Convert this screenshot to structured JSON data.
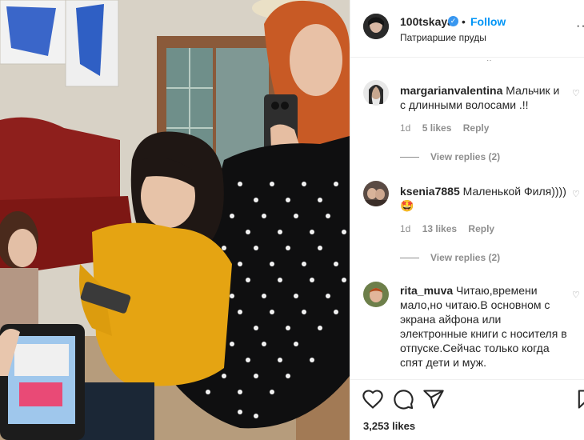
{
  "post": {
    "username": "100tskaya",
    "verified_icon": "verified-badge-icon",
    "separator": "•",
    "follow_label": "Follow",
    "location": "Патриаршие пруды",
    "more_label": "···"
  },
  "comments": [
    {
      "username": "margarianvalentina",
      "text": "Мальчик и с длинными волосами .!!",
      "age": "1d",
      "likes": "5 likes",
      "reply": "Reply",
      "view_replies": "View replies (2)"
    },
    {
      "username": "ksenia7885",
      "text": "Маленькой Филя))))",
      "emoji": "🤩",
      "age": "1d",
      "likes": "13 likes",
      "reply": "Reply",
      "view_replies": "View replies (2)"
    },
    {
      "username": "rita_muva",
      "text": "Читаю,времени мало,но читаю.В основном с экрана айфона или электронные книги с носителя в отпуске.Сейчас только когда спят дети и муж."
    }
  ],
  "footer": {
    "likes_count": "3,253 likes"
  },
  "icons": {
    "like": "heart-icon",
    "comment": "comment-icon",
    "share": "share-icon",
    "save": "bookmark-icon"
  },
  "colors": {
    "link": "#0095f6",
    "muted": "#8e8e8e",
    "text": "#262626",
    "verified": "#3897f0"
  }
}
